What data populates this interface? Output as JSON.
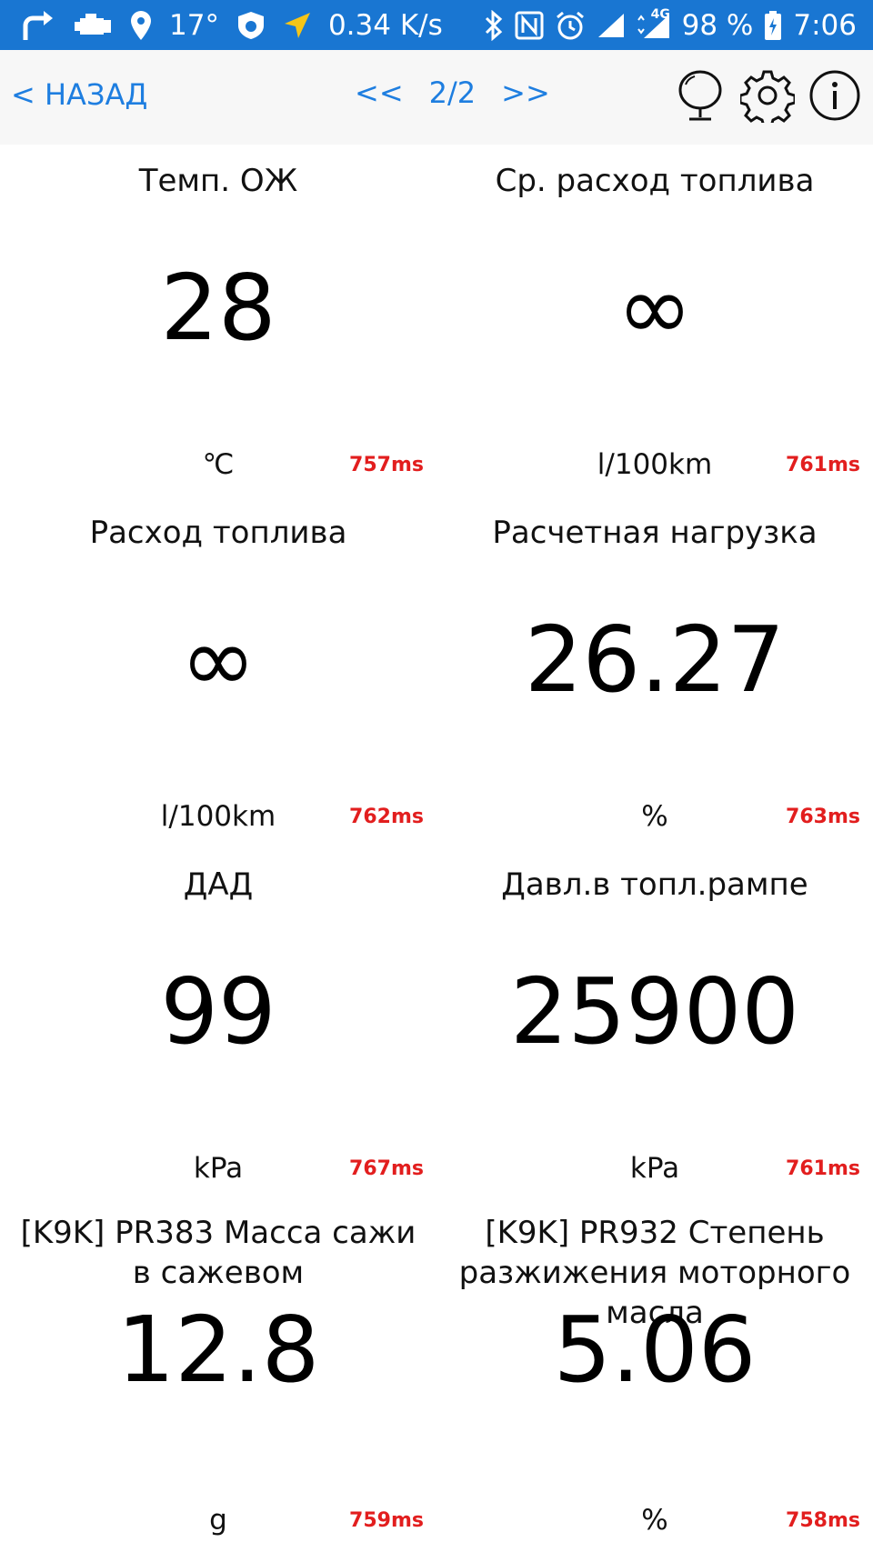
{
  "status_bar": {
    "temperature": "17°",
    "network_speed": "0.34 K/s",
    "battery": "98 %",
    "time": "7:06",
    "network_type": "4G",
    "icons": [
      "forward-arrow-icon",
      "engine-icon",
      "location-pin-icon",
      "bug-shield-icon",
      "navigation-arrow-icon",
      "bluetooth-icon",
      "nfc-icon",
      "alarm-icon",
      "signal-icon",
      "signal-4g-icon",
      "battery-charging-icon"
    ],
    "color": "#1976d2"
  },
  "nav": {
    "back_label": "< НАЗАД",
    "prev_label": "<<",
    "page_label": "2/2",
    "next_label": ">>",
    "icons": [
      "mirror-icon",
      "gear-icon",
      "info-icon"
    ],
    "accent_color": "#1e7ee0"
  },
  "gauges": [
    {
      "title": "Темп. ОЖ",
      "value": "28",
      "unit": "℃",
      "ms": "757ms"
    },
    {
      "title": "Ср. расход топлива",
      "value": "∞",
      "unit": "l/100km",
      "ms": "761ms"
    },
    {
      "title": "Расход топлива",
      "value": "∞",
      "unit": "l/100km",
      "ms": "762ms"
    },
    {
      "title": "Расчетная нагрузка",
      "value": "26.27",
      "unit": "%",
      "ms": "763ms"
    },
    {
      "title": "ДАД",
      "value": "99",
      "unit": "kPa",
      "ms": "767ms"
    },
    {
      "title": "Давл.в топл.рампе",
      "value": "25900",
      "unit": "kPa",
      "ms": "761ms"
    },
    {
      "title": "[K9K] PR383 Масса сажи в сажевом",
      "value": "12.8",
      "unit": "g",
      "ms": "759ms"
    },
    {
      "title": "[K9K] PR932 Степень разжижения моторного масла",
      "value": "5.06",
      "unit": "%",
      "ms": "758ms"
    }
  ],
  "ms_color": "#e21e1e"
}
